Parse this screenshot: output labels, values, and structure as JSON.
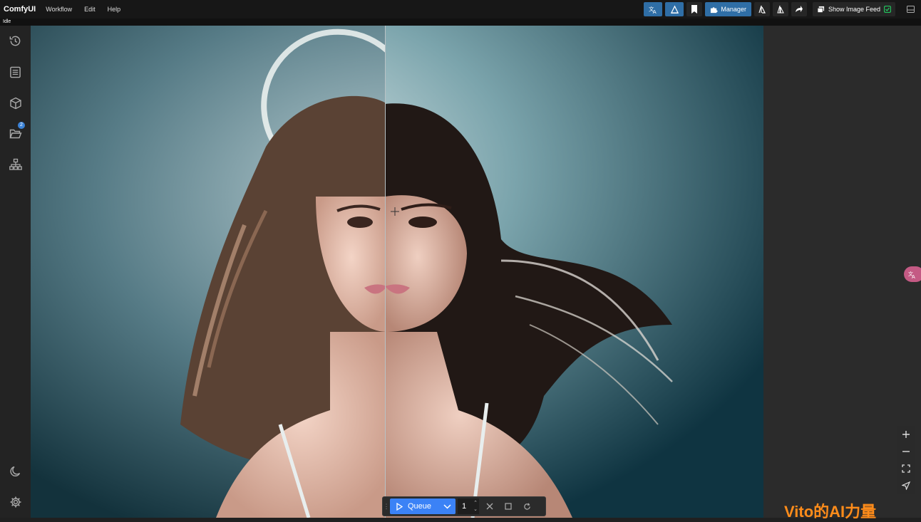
{
  "app": {
    "brand": "ComfyUI",
    "status": "Idle"
  },
  "menu": [
    {
      "label": "Workflow"
    },
    {
      "label": "Edit"
    },
    {
      "label": "Help"
    }
  ],
  "toolbar": {
    "manager_label": "Manager",
    "image_feed_label": "Show Image Feed"
  },
  "sidebar": {
    "items": [
      {
        "icon": "history-icon"
      },
      {
        "icon": "queue-list-icon"
      },
      {
        "icon": "model-library-icon"
      },
      {
        "icon": "workflows-folder-icon",
        "badge": "2"
      },
      {
        "icon": "node-library-icon"
      }
    ],
    "bottom": [
      {
        "icon": "theme-moon-icon"
      },
      {
        "icon": "settings-gear-icon"
      }
    ]
  },
  "queue": {
    "label": "Queue",
    "batch_count": "1"
  },
  "watermark": "Vito的AI力量",
  "colors": {
    "accent": "#3b82f6",
    "manager": "#2f6ea6",
    "topbar": "#171717",
    "canvas": "#2b2b2b"
  }
}
